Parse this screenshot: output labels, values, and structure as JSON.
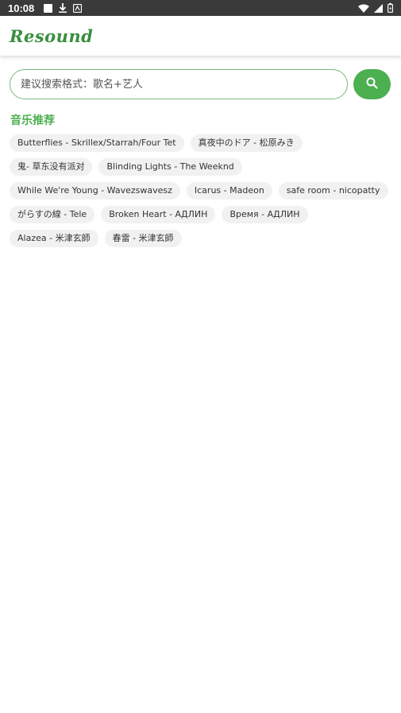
{
  "status_bar": {
    "time": "10:08",
    "left_icons": [
      "notification-square-icon",
      "download-icon",
      "app-notification-icon"
    ],
    "right_icons": [
      "wifi-icon",
      "cell-signal-icon",
      "battery-icon"
    ]
  },
  "app_bar": {
    "title": "Resound",
    "accent": "#3a8f3f"
  },
  "search": {
    "placeholder": "建议搜索格式：歌名+艺人",
    "value": "",
    "button_icon": "search-icon",
    "button_color": "#4caf50"
  },
  "recommend": {
    "title": "音乐推荐",
    "tags": [
      "Butterflies - Skrillex/Starrah/Four Tet",
      "真夜中のドア - 松原みき",
      "鬼- 草东没有派对",
      "Blinding Lights - The Weeknd",
      "While We're Young - Wavezswavesz",
      "Icarus - Madeon",
      "safe room - nicopatty",
      "がらすの線 - Tele",
      "Broken Heart - АДЛИН",
      "Время - АДЛИН",
      "Alazea - 米津玄師",
      "春雷 - 米津玄師"
    ]
  }
}
